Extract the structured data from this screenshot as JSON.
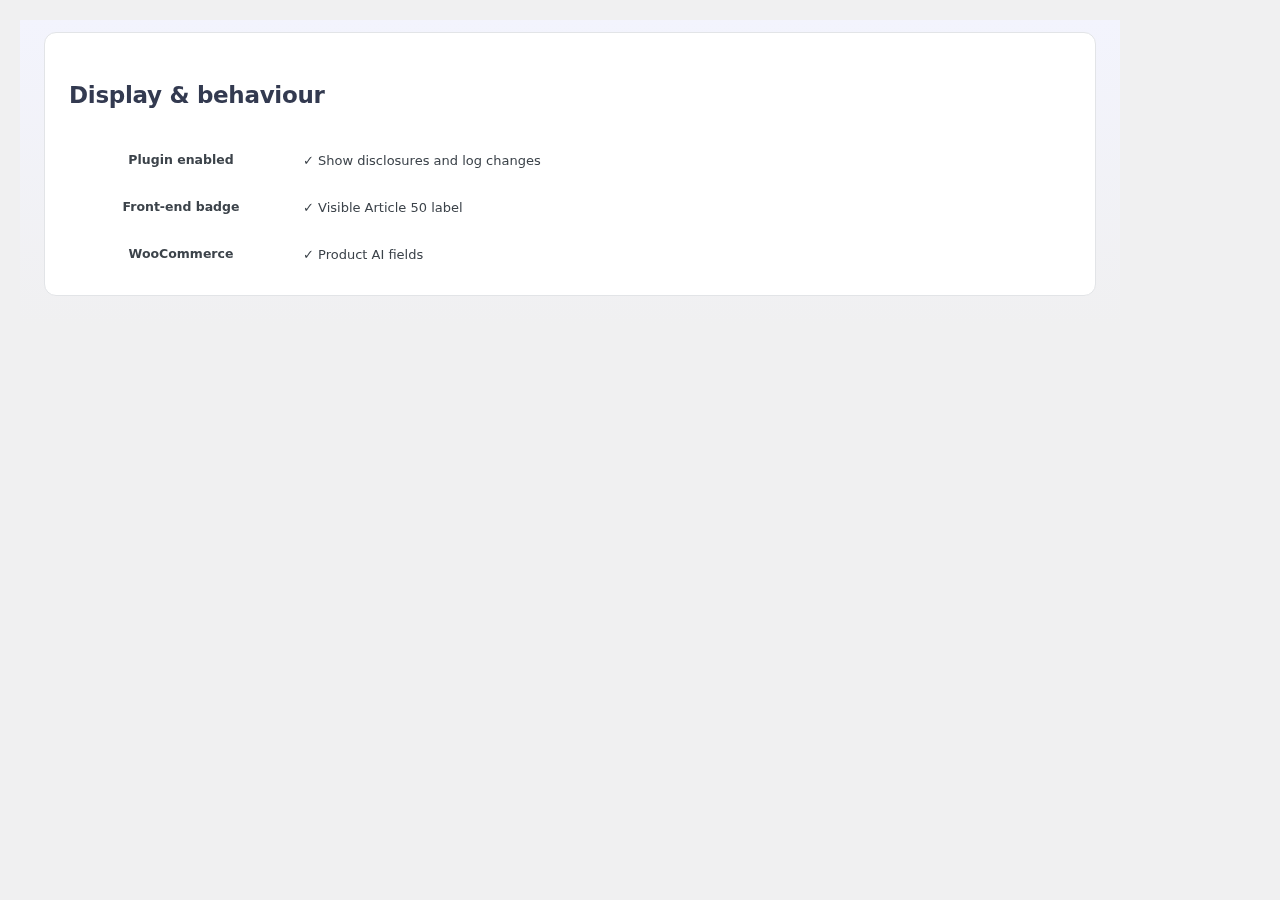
{
  "section": {
    "title": "Display & behaviour"
  },
  "rows": [
    {
      "label": "Plugin enabled",
      "value": "✓ Show disclosures and log changes"
    },
    {
      "label": "Front-end badge",
      "value": "✓ Visible Article 50 label"
    },
    {
      "label": "WooCommerce",
      "value": "✓ Product AI fields"
    }
  ]
}
